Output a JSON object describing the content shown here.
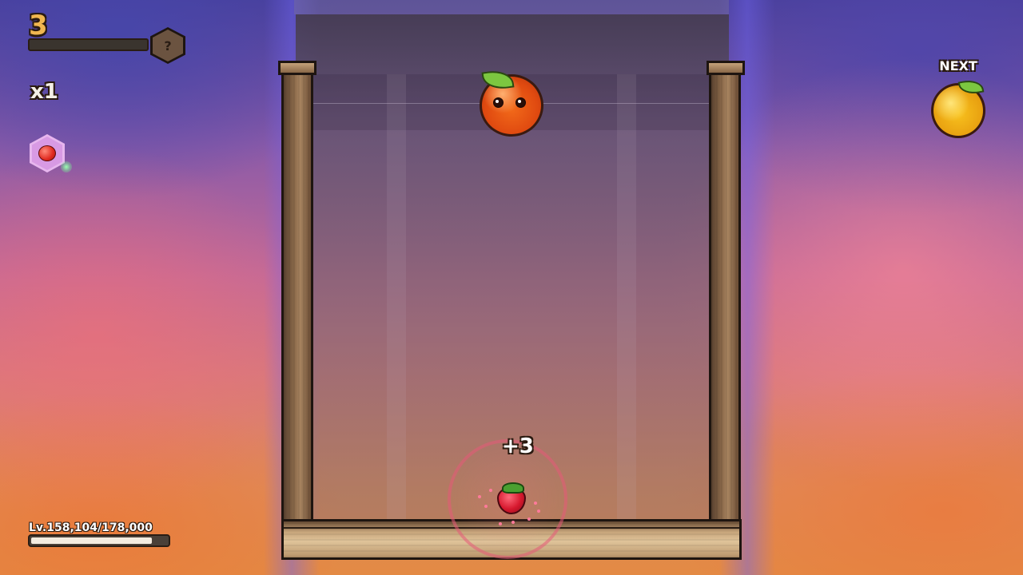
{
  "hud": {
    "score": "3",
    "score_progress": 0,
    "mystery_badge": "?",
    "multiplier": "x1",
    "powerup_icon": "apple-icon",
    "next_label": "NEXT",
    "next_fruit": "lemon"
  },
  "board": {
    "held_fruit": "orange",
    "merge_fruit": "strawberry",
    "merge_points": "+3"
  },
  "level": {
    "text": "Lv.158,104/178,000",
    "current": 158104,
    "max": 178000
  },
  "colors": {
    "score": "#f0b650",
    "wood": "#8c6a4a",
    "orange": "#f26a1a",
    "lemon": "#f8c21e",
    "strawberry": "#d6182e"
  }
}
